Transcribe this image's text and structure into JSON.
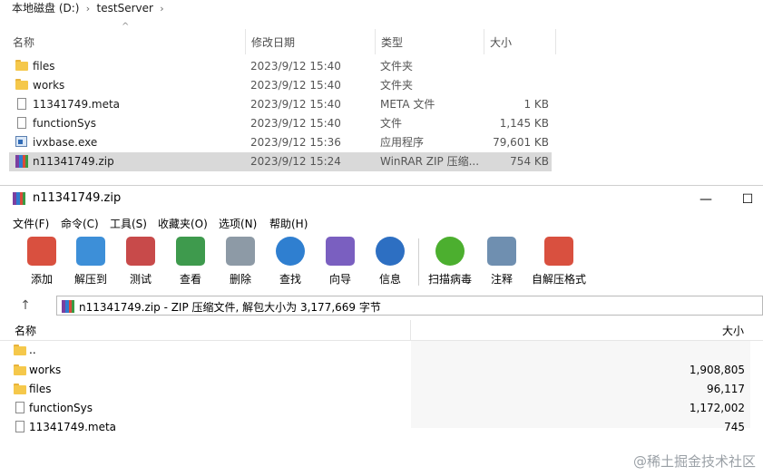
{
  "explorer": {
    "breadcrumb": [
      "本地磁盘 (D:)",
      "testServer"
    ],
    "columns": {
      "name": "名称",
      "date": "修改日期",
      "type": "类型",
      "size": "大小"
    },
    "files": [
      {
        "name": "files",
        "date": "2023/9/12 15:40",
        "type": "文件夹",
        "size": "",
        "icon": "folder-icon"
      },
      {
        "name": "works",
        "date": "2023/9/12 15:40",
        "type": "文件夹",
        "size": "",
        "icon": "folder-icon"
      },
      {
        "name": "11341749.meta",
        "date": "2023/9/12 15:40",
        "type": "META 文件",
        "size": "1 KB",
        "icon": "document-icon"
      },
      {
        "name": "functionSys",
        "date": "2023/9/12 15:40",
        "type": "文件",
        "size": "1,145 KB",
        "icon": "document-icon"
      },
      {
        "name": "ivxbase.exe",
        "date": "2023/9/12 15:36",
        "type": "应用程序",
        "size": "79,601 KB",
        "icon": "exe-icon"
      },
      {
        "name": "n11341749.zip",
        "date": "2023/9/12 15:24",
        "type": "WinRAR ZIP 压缩...",
        "size": "754 KB",
        "icon": "winrar-icon"
      }
    ]
  },
  "winrar": {
    "title": "n11341749.zip",
    "menu": [
      "文件(F)",
      "命令(C)",
      "工具(S)",
      "收藏夹(O)",
      "选项(N)",
      "帮助(H)"
    ],
    "toolbar": [
      {
        "label": "添加",
        "icon": "add-archive-icon",
        "color": "#d9503f"
      },
      {
        "label": "解压到",
        "icon": "extract-folder-icon",
        "color": "#3d8fd8"
      },
      {
        "label": "测试",
        "icon": "test-clipboard-icon",
        "color": "#c84a4a"
      },
      {
        "label": "查看",
        "icon": "view-book-icon",
        "color": "#3e9a4d"
      },
      {
        "label": "删除",
        "icon": "trash-icon",
        "color": "#8d9aa6"
      },
      {
        "label": "查找",
        "icon": "magnifier-icon",
        "color": "#2f7fd0"
      },
      {
        "label": "向导",
        "icon": "wizard-wand-icon",
        "color": "#7a5fc0"
      },
      {
        "label": "信息",
        "icon": "info-icon",
        "color": "#2d6fc2"
      },
      {
        "label": "扫描病毒",
        "icon": "virus-scan-icon",
        "color": "#4caf2f"
      },
      {
        "label": "注释",
        "icon": "comment-icon",
        "color": "#6f8fb0"
      },
      {
        "label": "自解压格式",
        "icon": "sfx-archive-icon",
        "color": "#d9503f"
      }
    ],
    "path_text": "n11341749.zip - ZIP 压缩文件, 解包大小为 3,177,669 字节",
    "columns": {
      "name": "名称",
      "size": "大小"
    },
    "entries": [
      {
        "name": "..",
        "size": "",
        "icon": "folder-icon"
      },
      {
        "name": "works",
        "size": "1,908,805",
        "icon": "folder-icon"
      },
      {
        "name": "files",
        "size": "96,117",
        "icon": "folder-icon"
      },
      {
        "name": "functionSys",
        "size": "1,172,002",
        "icon": "document-icon"
      },
      {
        "name": "11341749.meta",
        "size": "745",
        "icon": "document-icon"
      }
    ]
  },
  "watermark": "@稀土掘金技术社区"
}
